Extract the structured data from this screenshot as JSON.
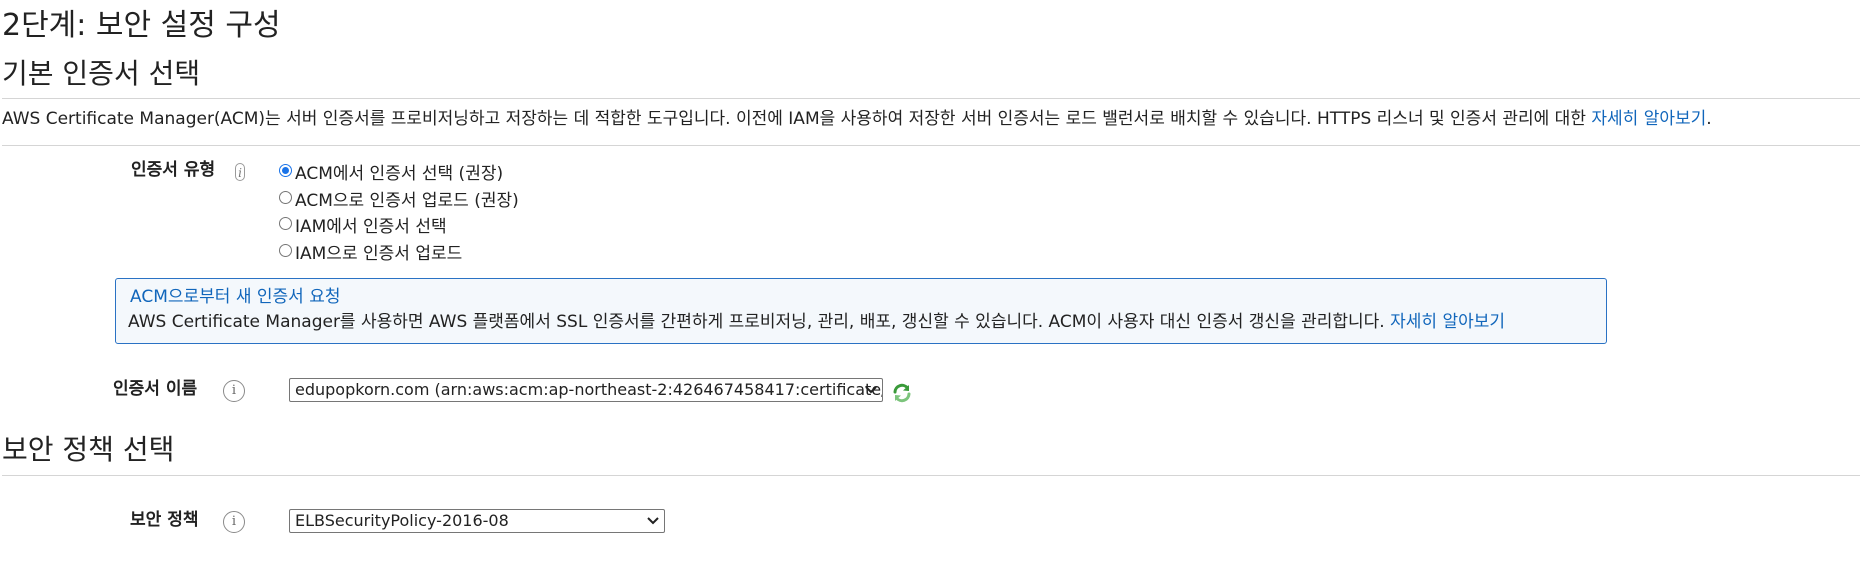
{
  "page": {
    "title": "2단계: 보안 설정 구성"
  },
  "certificate_section": {
    "title": "기본 인증서 선택",
    "description": "AWS Certificate Manager(ACM)는 서버 인증서를 프로비저닝하고 저장하는 데 적합한 도구입니다. 이전에 IAM을 사용하여 저장한 서버 인증서는 로드 밸런서로 배치할 수 있습니다. HTTPS 리스너 및 인증서 관리에 대한 ",
    "learn_more_link": "자세히 알아보기",
    "description_suffix": ".",
    "type_label": "인증서 유형",
    "type_info_icon": "i",
    "type_options": [
      {
        "label": "ACM에서 인증서 선택 (권장)",
        "checked": true
      },
      {
        "label": "ACM으로 인증서 업로드 (권장)",
        "checked": false
      },
      {
        "label": "IAM에서 인증서 선택",
        "checked": false
      },
      {
        "label": "IAM으로 인증서 업로드",
        "checked": false
      }
    ],
    "acm_box": {
      "title_link": "ACM으로부터 새 인증서 요청",
      "text": "AWS Certificate Manager를 사용하면 AWS 플랫폼에서 SSL 인증서를 간편하게 프로비저닝, 관리, 배포, 갱신할 수 있습니다. ACM이 사용자 대신 인증서 갱신을 관리합니다. ",
      "learn_more_link": "자세히 알아보기"
    },
    "name_label": "인증서 이름",
    "name_info_icon": "i",
    "name_selected": "edupopkorn.com (arn:aws:acm:ap-northeast-2:426467458417:certificate/",
    "refresh_icon": "refresh-icon"
  },
  "policy_section": {
    "title": "보안 정책 선택",
    "policy_label": "보안 정책",
    "policy_info_icon": "i",
    "policy_selected": "ELBSecurityPolicy-2016-08"
  },
  "colors": {
    "link": "#1166bb",
    "info_box_border": "#2a72c4",
    "radio_checked": "#1a73e8",
    "refresh_icon": "#3a9a3a"
  }
}
